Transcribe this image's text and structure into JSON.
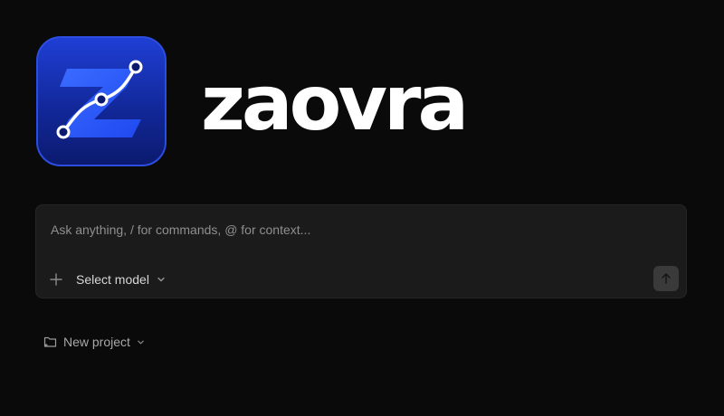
{
  "brand": {
    "name": "zaovra",
    "logo_icon": "zaovra-logo-icon",
    "colors": {
      "tile_top": "#1f3fd6",
      "tile_bottom": "#0b1a6e",
      "z_fill": "#2d5bff",
      "curve": "#ffffff"
    }
  },
  "prompt": {
    "placeholder": "Ask anything, / for commands, @ for context...",
    "value": "",
    "add_icon": "plus-icon",
    "model_label": "Select model",
    "model_icon": "chevron-down-icon",
    "send_icon": "arrow-up-icon"
  },
  "project": {
    "label": "New project",
    "icon": "folder-icon",
    "chevron_icon": "chevron-down-icon"
  }
}
